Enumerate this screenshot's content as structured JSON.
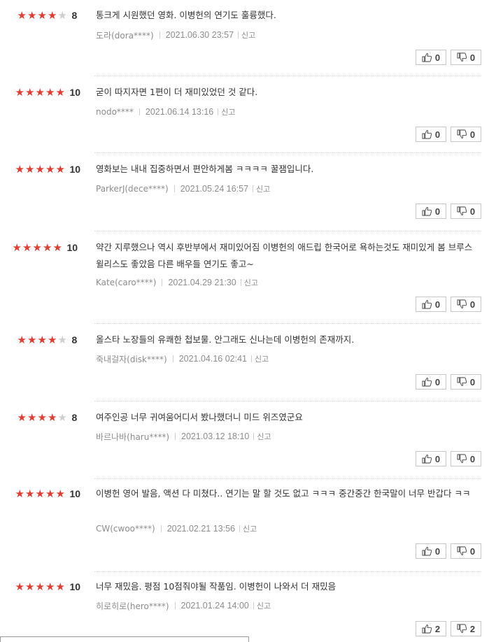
{
  "reviews": [
    {
      "stars": 4,
      "score": "8",
      "text": "통크게 시원했던 영화. 이병헌의 연기도 훌륭했다.",
      "user": "도라(dora****)",
      "date": "2021.06.30 23:57",
      "report": "신고",
      "likes": "0",
      "dislikes": "0"
    },
    {
      "stars": 5,
      "score": "10",
      "text": "굳이 따지자면 1편이 더 재미있었던 것 같다.",
      "user": "nodo****",
      "date": "2021.06.14 13:16",
      "report": "신고",
      "likes": "0",
      "dislikes": "0"
    },
    {
      "stars": 5,
      "score": "10",
      "text": "영화보는 내내 집중하면서 편안하게봄 ㅋㅋㅋㅋ 꿀잼입니다.",
      "user": "ParkerJ(dece****)",
      "date": "2021.05.24 16:57",
      "report": "신고",
      "likes": "0",
      "dislikes": "0"
    },
    {
      "stars": 5,
      "score": "10",
      "text": "약간 지루했으나 역시 후반부에서 재미있어짐 이병헌의 애드립 한국어로 욕하는것도 재미있게 봄 브루스윌리스도 좋았음 다른 배우들 연기도 좋고~",
      "user": "Kate(caro****)",
      "date": "2021.04.29 21:30",
      "report": "신고",
      "likes": "0",
      "dislikes": "0"
    },
    {
      "stars": 4,
      "score": "8",
      "text": "올스타 노장들의 유쾌한 첩보물. 안그래도 신나는데 이병헌의 존재까지.",
      "user": "죽내걸자(disk****)",
      "date": "2021.04.16 02:41",
      "report": "신고",
      "likes": "0",
      "dislikes": "0"
    },
    {
      "stars": 4,
      "score": "8",
      "text": "여주인공 너무 귀여움어디서 봤나했더니 미드 위즈였군요",
      "user": "바르나바(haru****)",
      "date": "2021.03.12 18:10",
      "report": "신고",
      "likes": "0",
      "dislikes": "0"
    },
    {
      "stars": 5,
      "score": "10",
      "text": "이병헌 영어 발음, 액션 다 미쳤다.. 연기는 말 할 것도 없고 ㅋㅋㅋ 중간중간 한국말이 너무 반갑다 ㅋㅋ",
      "user": "CW(cwoo****)",
      "date": "2021.02.21 13:56",
      "report": "신고",
      "likes": "0",
      "dislikes": "0"
    },
    {
      "stars": 5,
      "score": "10",
      "text": "너무 재밌음. 평점 10점줘야될 작품임. 이병헌이 나와서 더 재밌음",
      "user": "히로히로(hero****)",
      "date": "2021.01.24 14:00",
      "report": "신고",
      "likes": "2",
      "dislikes": "2"
    }
  ],
  "colors": {
    "star_on": "#e8392e",
    "star_off": "#cfcfcf"
  },
  "icons": {
    "like": "thumbs-up-icon",
    "dislike": "thumbs-down-icon",
    "star": "star-icon"
  }
}
